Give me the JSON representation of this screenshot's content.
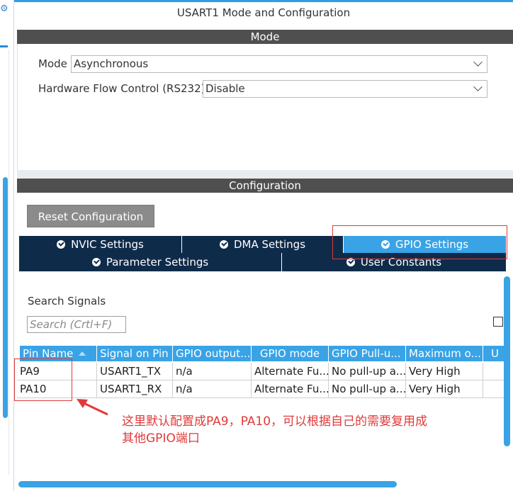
{
  "title": "USART1 Mode and Configuration",
  "mode_section": {
    "header": "Mode",
    "mode_label": "Mode",
    "mode_value": "Asynchronous",
    "flow_label": "Hardware Flow Control (RS232)",
    "flow_value": "Disable"
  },
  "config_section": {
    "header": "Configuration",
    "reset_button": "Reset Configuration",
    "tabs_row1": [
      "NVIC Settings",
      "DMA Settings",
      "GPIO Settings"
    ],
    "tabs_row2": [
      "Parameter Settings",
      "User Constants"
    ],
    "active_tab": "GPIO Settings"
  },
  "search": {
    "label": "Search Signals",
    "placeholder": "Search (Crtl+F)"
  },
  "table": {
    "columns": [
      "Pin Name",
      "Signal on Pin",
      "GPIO output...",
      "GPIO mode",
      "GPIO Pull-u...",
      "Maximum o...",
      "U"
    ],
    "rows": [
      [
        "PA9",
        "USART1_TX",
        "n/a",
        "Alternate Fu...",
        "No pull-up a...",
        "Very High",
        ""
      ],
      [
        "PA10",
        "USART1_RX",
        "n/a",
        "Alternate Fu...",
        "No pull-up a...",
        "Very High",
        ""
      ]
    ]
  },
  "annotation": {
    "line1": "这里默认配置成PA9，PA10，可以根据自己的需要复用成",
    "line2": "其他GPIO端口",
    "color": "#e03a3a"
  },
  "colors": {
    "accent": "#39a3e6",
    "tab_dark": "#0f2b4a",
    "section_bar": "#4f4f4f"
  }
}
